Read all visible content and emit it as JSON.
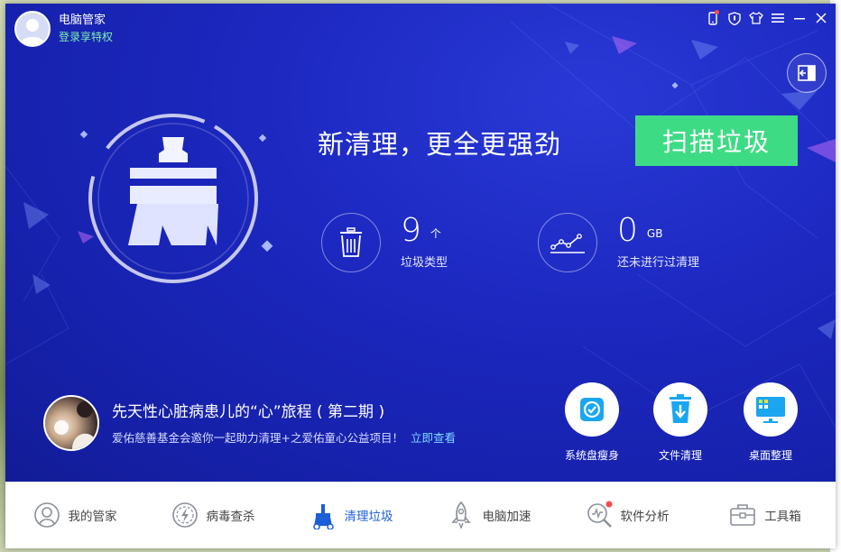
{
  "header": {
    "app_name": "电脑管家",
    "login_link": "登录享特权"
  },
  "hero": {
    "headline": "新清理，更全更强劲",
    "scan_button": "扫描垃圾"
  },
  "stats": [
    {
      "value": "9",
      "unit": "个",
      "label": "垃圾类型",
      "icon": "trash-icon"
    },
    {
      "value": "0",
      "unit": "GB",
      "label": "还未进行过清理",
      "icon": "trend-chart-icon"
    }
  ],
  "promo": {
    "title": "先天性心脏病患儿的“心”旅程 ( 第二期 )",
    "description": "爱佑慈善基金会邀你一起助力清理+之爱佑童心公益项目！",
    "link": "立即查看"
  },
  "tools": [
    {
      "label": "系统盘瘦身",
      "icon": "disk-slim-icon"
    },
    {
      "label": "文件清理",
      "icon": "file-clean-icon"
    },
    {
      "label": "桌面整理",
      "icon": "desktop-organize-icon"
    }
  ],
  "nav": [
    {
      "label": "我的管家",
      "icon": "butler-icon"
    },
    {
      "label": "病毒查杀",
      "icon": "virus-scan-icon"
    },
    {
      "label": "清理垃圾",
      "icon": "clean-icon",
      "active": true
    },
    {
      "label": "电脑加速",
      "icon": "rocket-icon"
    },
    {
      "label": "软件分析",
      "icon": "software-analysis-icon",
      "badge": true
    },
    {
      "label": "工具箱",
      "icon": "toolbox-icon"
    }
  ],
  "colors": {
    "primary_blue": "#1c28c0",
    "scan_green": "#3ddc84",
    "link_green": "#7ff0b0",
    "active_nav": "#1c5fd6",
    "badge_red": "#ff4a4a"
  }
}
